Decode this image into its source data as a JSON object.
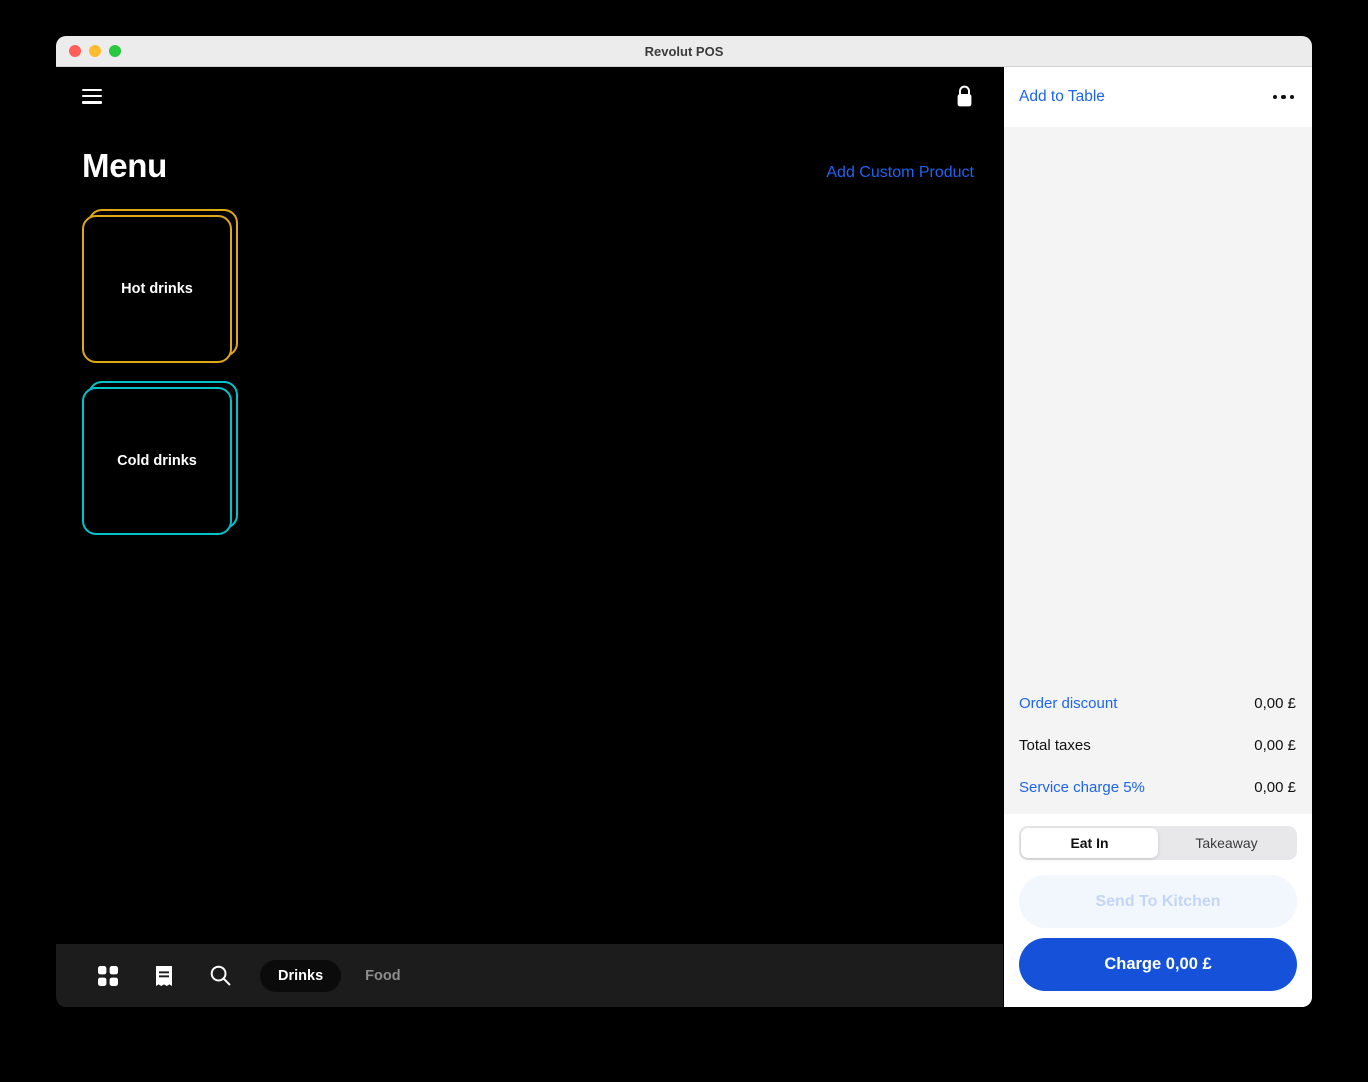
{
  "window": {
    "title": "Revolut POS",
    "traffic_lights": [
      "close",
      "minimize",
      "maximize"
    ]
  },
  "pos": {
    "menu_icon": "hamburger-icon",
    "lock_icon": "lock-icon",
    "page_title": "Menu",
    "add_custom_product_label": "Add Custom Product",
    "categories": [
      {
        "label": "Hot drinks",
        "color": "#e0a816"
      },
      {
        "label": "Cold drinks",
        "color": "#00c2cb"
      }
    ],
    "toolbar": {
      "icons": [
        "grid-icon",
        "receipt-icon",
        "search-icon"
      ],
      "tabs": [
        {
          "label": "Drinks",
          "active": true
        },
        {
          "label": "Food",
          "active": false
        }
      ]
    }
  },
  "cart": {
    "add_to_table_label": "Add to Table",
    "more_options_icon": "ellipsis-icon",
    "summary": [
      {
        "label": "Order discount",
        "value": "0,00 £",
        "link": true
      },
      {
        "label": "Total taxes",
        "value": "0,00 £",
        "link": false
      },
      {
        "label": "Service charge 5%",
        "value": "0,00 £",
        "link": true
      }
    ],
    "service_mode": [
      {
        "label": "Eat In",
        "active": true
      },
      {
        "label": "Takeaway",
        "active": false
      }
    ],
    "send_to_kitchen_label": "Send To Kitchen",
    "charge_label": "Charge 0,00 £"
  },
  "colors": {
    "accent_blue": "#1c64f2",
    "charge_blue": "#1552d9",
    "hot_drinks": "#e0a816",
    "cold_drinks": "#00c2cb",
    "cart_bg": "#f4f4f5",
    "toolbar_bg": "#1c1c1c"
  }
}
